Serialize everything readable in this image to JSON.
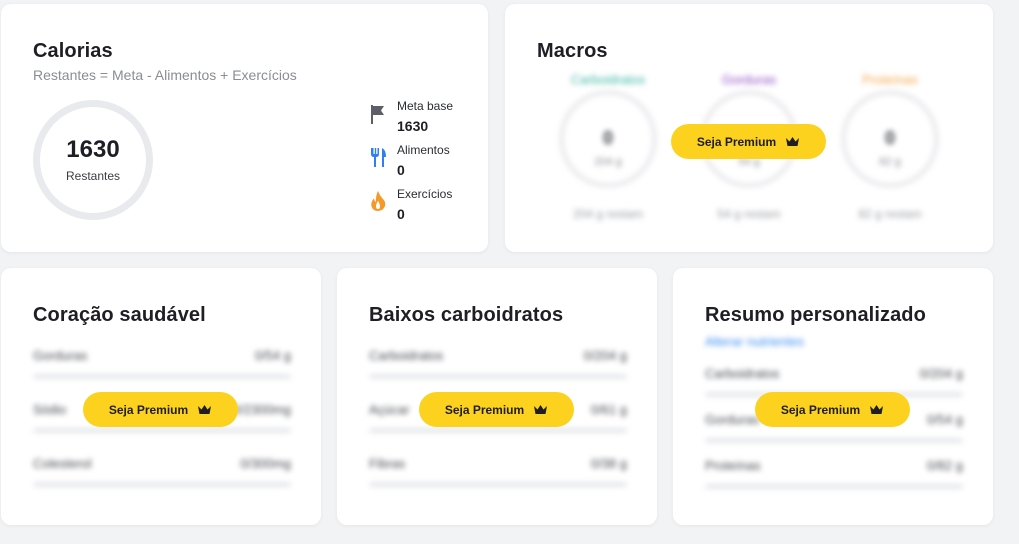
{
  "calorias": {
    "title": "Calorias",
    "subtitle": "Restantes = Meta - Alimentos + Exercícios",
    "remaining_value": "1630",
    "remaining_label": "Restantes",
    "stats": [
      {
        "label": "Meta base",
        "value": "1630",
        "icon": "flag-icon",
        "color": "#5c5f66"
      },
      {
        "label": "Alimentos",
        "value": "0",
        "icon": "fork-knife-icon",
        "color": "#2f7ff0"
      },
      {
        "label": "Exercícios",
        "value": "0",
        "icon": "flame-icon",
        "color": "#f39a2b"
      }
    ]
  },
  "macros": {
    "title": "Macros",
    "items": [
      {
        "label": "Carboidratos",
        "value": "0",
        "unit": "204 g",
        "remaining": "204 g restam",
        "color": "#3ab5a2"
      },
      {
        "label": "Gorduras",
        "value": "0",
        "unit": "54 g",
        "remaining": "54 g restam",
        "color": "#8d4fc4"
      },
      {
        "label": "Proteínas",
        "value": "0",
        "unit": "82 g",
        "remaining": "82 g restam",
        "color": "#f2a64a"
      }
    ]
  },
  "premium_label": "Seja Premium",
  "heart": {
    "title": "Coração saudável",
    "rows": [
      {
        "label": "Gorduras",
        "value": "0/54 g"
      },
      {
        "label": "Sódio",
        "value": "0/2300mg"
      },
      {
        "label": "Colesterol",
        "value": "0/300mg"
      }
    ]
  },
  "lowcarb": {
    "title": "Baixos carboidratos",
    "rows": [
      {
        "label": "Carboidratos",
        "value": "0/204 g"
      },
      {
        "label": "Açúcar",
        "value": "0/61 g"
      },
      {
        "label": "Fibras",
        "value": "0/38 g"
      }
    ]
  },
  "summary": {
    "title": "Resumo personalizado",
    "link": "Alterar nutrientes",
    "rows": [
      {
        "label": "Carboidratos",
        "value": "0/204 g"
      },
      {
        "label": "Gorduras",
        "value": "0/54 g"
      },
      {
        "label": "Proteínas",
        "value": "0/82 g"
      }
    ]
  }
}
